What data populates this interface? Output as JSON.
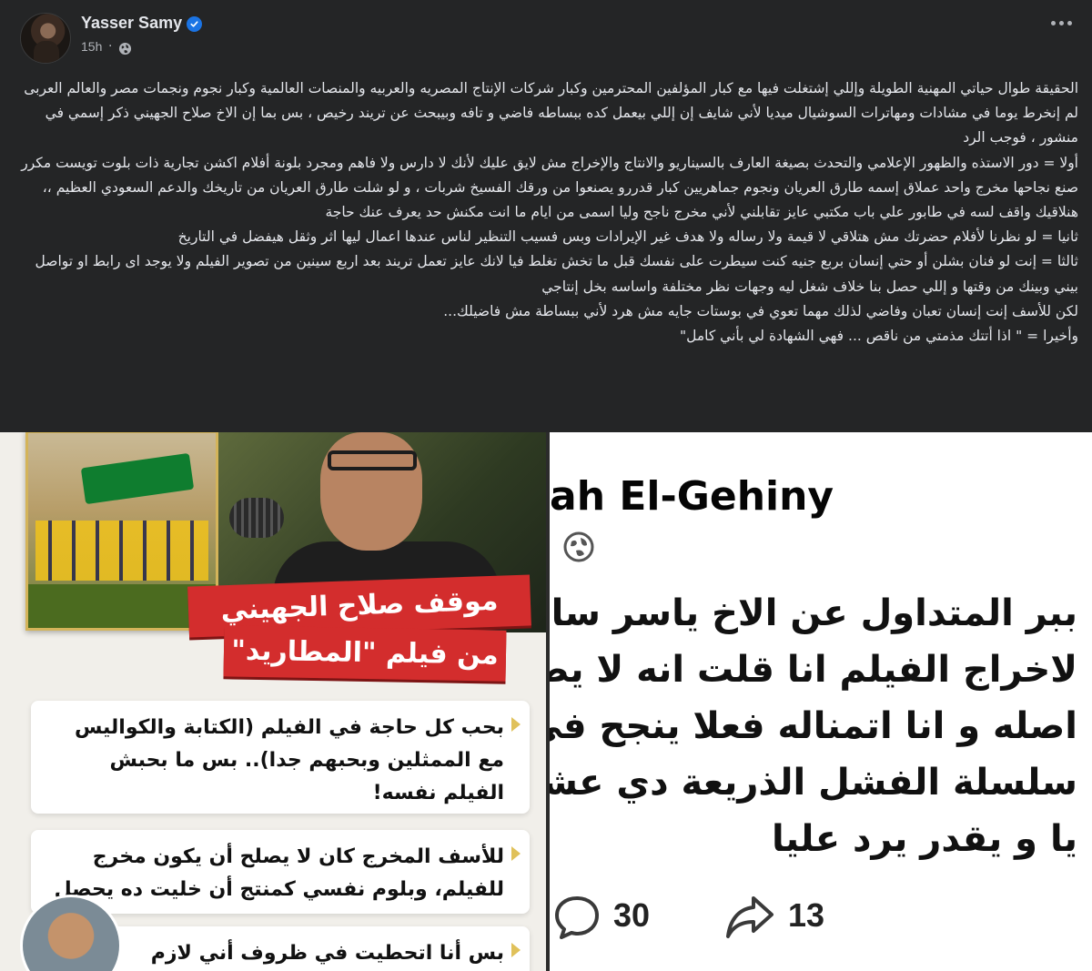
{
  "post": {
    "author": "Yasser Samy",
    "time": "15h",
    "dot": "·",
    "paragraphs": [
      "الحقيقة طوال حياتي المهنية الطويلة وإللي إشتغلت فيها مع كبار المؤلفين المحترمين وكبار شركات الإنتاج المصريه والعربيه والمنصات العالمية وكبار نجوم ونجمات مصر والعالم العربى لم إنخرط يوما في مشادات ومهاترات السوشيال ميديا لأني شايف إن إللي بيعمل كده ببساطه فاضي و تافه وبيبحث عن تريند رخيص ، بس بما إن الاخ صلاح الجهيني ذكر إسمي في منشور ، فوجب الرد",
      "أولا = دور الاستذه والظهور الإعلامي والتحدث بصيغة العارف بالسيناريو والانتاج والإخراج مش لايق عليك لأنك لا دارس ولا فاهم ومجرد بلونة أفلام اكشن تجارية ذات بلوت تويست مكرر صنع نجاحها مخرج واحد عملاق إسمه طارق العريان ونجوم جماهريين كبار قدررو يصنعوا من ورقك الفسيخ شربات ، و لو شلت طارق العريان من تاريخك والدعم السعودي العظيم ،، هنلاقيك واقف لسه في طابور علي باب مكتبي عايز تقابلني لأني مخرج ناجح وليا اسمى من ايام ما انت مكنش حد يعرف عنك حاجة",
      "ثانيا = لو نظرنا لأفلام حضرتك مش هتلاقي لا قيمة ولا رساله ولا هدف غير الإيرادات وبس فسيب التنظير لناس عندها اعمال ليها اثر وثقل هيفضل في التاريخ",
      "ثالثا = إنت لو فنان بشلن أو حتي إنسان بربع جنيه كنت سيطرت على نفسك قبل ما تخش تغلط فيا لانك عايز تعمل تريند بعد اربع سينين من تصوير الفيلم ولا يوجد اى رابط او تواصل بيني وبينك من وقتها و إللي حصل بنا خلاف شغل ليه وجهات نظر مختلفة واساسه بخل إنتاجي",
      "لكن للأسف إنت إنسان تعبان وفاضي لذلك مهما تعوي في بوستات جايه مش هرد لأني ببساطة مش فاضيلك...",
      "وأخيرا = \" اذا أتتك مذمتي من ناقص ... فهي الشهادة لي بأني كامل\""
    ]
  },
  "left_image": {
    "banner_line_1": "موقف صلاح الجهيني",
    "banner_line_2": "من فيلم \"المطاريد\"",
    "card_1": "بحب كل حاجة في الفيلم (الكتابة والكواليس مع الممثلين وبحبهم جدا).. بس ما بحبش الفيلم نفسه!",
    "card_2": "للأسف المخرج كان لا يصلح أن يكون مخرج للفيلم، وبلوم نفسي كمنتج أن خليت ده يحصل",
    "card_3": "بس أنا اتحطيت في ظروف أني لازم"
  },
  "right_image": {
    "profile_name": "ah El-Gehiny",
    "lines": [
      "ببر المتداول عن الاخ ياسر سامي",
      "لاخراج الفيلم انا قلت انه لا يصلح",
      "اصله و انا اتمناله فعلا ينجح في",
      "سلسلة الفشل الذريعة دي عشان",
      "يا و يقدر يرد عليا"
    ],
    "comments": "30",
    "shares": "13"
  },
  "icons": {
    "verified": "verified-badge-icon",
    "audience": "globe-icon",
    "menu": "more-options-icon",
    "comment": "comment-icon",
    "share": "share-icon"
  },
  "colors": {
    "background": "#242526",
    "text": "#e4e6eb",
    "muted": "#b0b3b8",
    "verified": "#1b74e4",
    "banner": "#d32d2d"
  }
}
